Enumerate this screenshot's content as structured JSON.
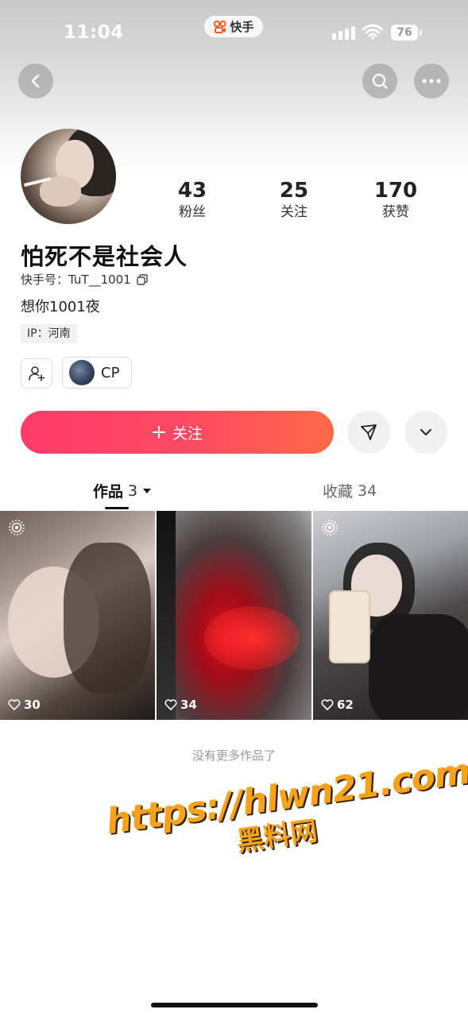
{
  "status_bar": {
    "time": "11:04",
    "app_label": "快手",
    "battery": "76"
  },
  "profile": {
    "nickname": "怕死不是社会人",
    "kuaishou_id_label": "快手号：",
    "kuaishou_id": "TuT__1001",
    "bio": "想你1001夜",
    "ip": "IP：河南",
    "cp_label": "CP",
    "stats": [
      {
        "value": "43",
        "label": "粉丝"
      },
      {
        "value": "25",
        "label": "关注"
      },
      {
        "value": "170",
        "label": "获赞"
      }
    ]
  },
  "actions": {
    "follow_label": "关注"
  },
  "tabs": {
    "works_label": "作品",
    "works_count": "3",
    "collect_label": "收藏",
    "collect_count": "34"
  },
  "works": [
    {
      "likes": "30"
    },
    {
      "likes": "34"
    },
    {
      "likes": "62"
    }
  ],
  "footer_text": "没有更多作品了",
  "watermark": {
    "url": "https://hlwn21.com",
    "name": "黑料网"
  },
  "colors": {
    "accent_start": "#ff3b6b",
    "accent_end": "#ff6a48",
    "watermark": "#f6a21a"
  }
}
